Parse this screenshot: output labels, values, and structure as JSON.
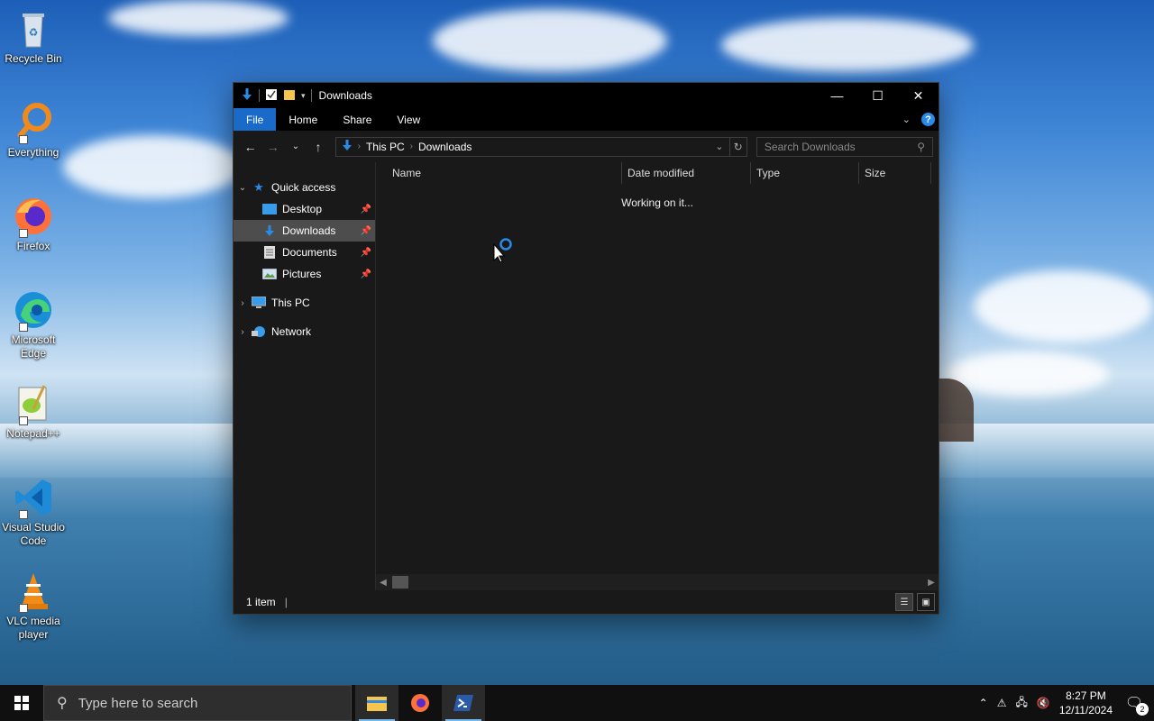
{
  "desktop": {
    "icons": [
      {
        "label": "Recycle Bin"
      },
      {
        "label": "Everything"
      },
      {
        "label": "Firefox"
      },
      {
        "label": "Microsoft Edge"
      },
      {
        "label": "Notepad++"
      },
      {
        "label": "Visual Studio Code"
      },
      {
        "label": "VLC media player"
      }
    ]
  },
  "window": {
    "title": "Downloads",
    "ribbon_tabs": [
      "File",
      "Home",
      "Share",
      "View"
    ],
    "help_label": "?",
    "address": {
      "segments": [
        "This PC",
        "Downloads"
      ]
    },
    "search": {
      "placeholder": "Search Downloads"
    },
    "nav": {
      "quick_access": "Quick access",
      "items": [
        "Desktop",
        "Downloads",
        "Documents",
        "Pictures"
      ],
      "this_pc": "This PC",
      "network": "Network"
    },
    "columns": [
      "Name",
      "Date modified",
      "Type",
      "Size"
    ],
    "working_text": "Working on it...",
    "status": "1 item"
  },
  "taskbar": {
    "search_placeholder": "Type here to search",
    "time": "8:27 PM",
    "date": "12/11/2024",
    "notification_count": "2"
  },
  "colors": {
    "accent": "#1a6bc9",
    "window_bg": "#191919",
    "selection": "#4d4d4d"
  }
}
